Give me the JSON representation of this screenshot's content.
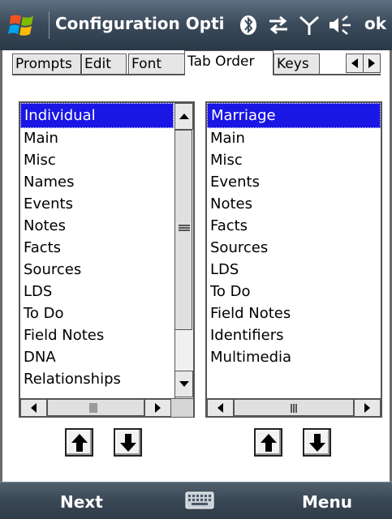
{
  "titlebar": {
    "title": "Configuration Opti",
    "ok_label": "ok",
    "icons": [
      "windows-start-icon",
      "bluetooth-icon",
      "sync-arrows-icon",
      "signal-antenna-icon",
      "volume-icon"
    ]
  },
  "tabs": [
    {
      "label": "Prompts",
      "active": false
    },
    {
      "label": "Edit",
      "active": false
    },
    {
      "label": "Font",
      "active": false
    },
    {
      "label": "Tab Order",
      "active": true
    },
    {
      "label": "Keys",
      "active": false
    }
  ],
  "left_list": {
    "header": "Individual",
    "items": [
      "Main",
      "Misc",
      "Names",
      "Events",
      "Notes",
      "Facts",
      "Sources",
      "LDS",
      "To Do",
      "Field Notes",
      "DNA",
      "Relationships"
    ]
  },
  "right_list": {
    "header": "Marriage",
    "items": [
      "Main",
      "Misc",
      "Events",
      "Notes",
      "Facts",
      "Sources",
      "LDS",
      "To Do",
      "Field Notes",
      "Identifiers",
      "Multimedia"
    ]
  },
  "softbar": {
    "left_label": "Next",
    "right_label": "Menu"
  },
  "colors": {
    "selection": "#1a16e4",
    "titlebar": "#3c4c5c"
  }
}
